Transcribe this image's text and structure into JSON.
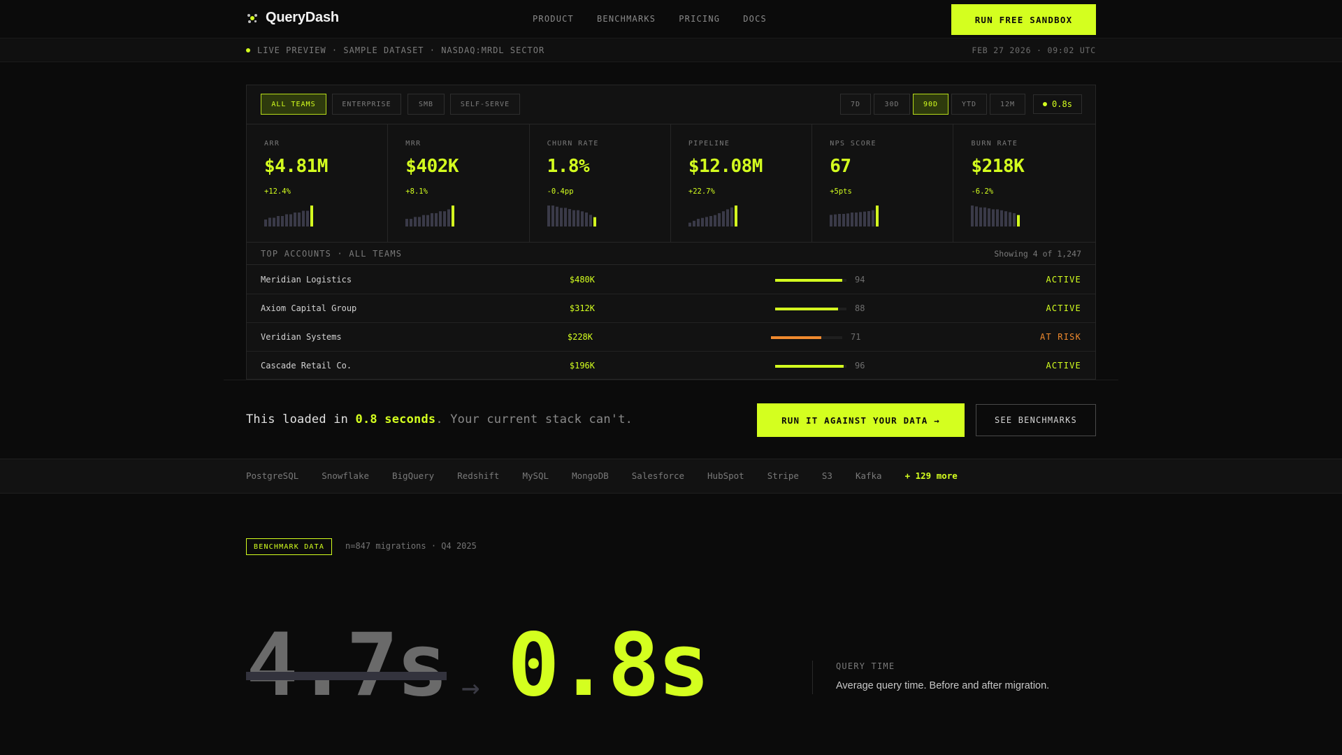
{
  "nav": {
    "brand": "QueryDash",
    "links": [
      "PRODUCT",
      "BENCHMARKS",
      "PRICING",
      "DOCS"
    ],
    "cta": "RUN FREE SANDBOX"
  },
  "livebar": {
    "text": "LIVE PREVIEW · SAMPLE DATASET · NASDAQ:MRDL SECTOR",
    "timestamp": "FEB 27 2026 · 09:02 UTC"
  },
  "filters": {
    "segments": [
      "ALL TEAMS",
      "ENTERPRISE",
      "SMB",
      "SELF-SERVE"
    ],
    "active_segment": "ALL TEAMS",
    "ranges": [
      "7D",
      "30D",
      "90D",
      "YTD",
      "12M"
    ],
    "active_range": "90D",
    "latency": "0.8s"
  },
  "kpis": [
    {
      "label": "ARR",
      "value": "$4.81M",
      "delta": "+12.4%",
      "spark": [
        4,
        5,
        5,
        6,
        6,
        7,
        7,
        8,
        8,
        9,
        9,
        12
      ]
    },
    {
      "label": "MRR",
      "value": "$402K",
      "delta": "+8.1%",
      "spark": [
        4,
        4,
        5,
        5,
        6,
        6,
        7,
        7,
        8,
        8,
        9,
        11
      ]
    },
    {
      "label": "CHURN RATE",
      "value": "1.8%",
      "delta": "-0.4pp",
      "spark": [
        9,
        9,
        8.5,
        8,
        8,
        7.5,
        7,
        7,
        6.5,
        6,
        5,
        4
      ]
    },
    {
      "label": "PIPELINE",
      "value": "$12.08M",
      "delta": "+22.7%",
      "spark": [
        2,
        3,
        4,
        4.5,
        5,
        5.5,
        6,
        7,
        8,
        9,
        10,
        11
      ]
    },
    {
      "label": "NPS SCORE",
      "value": "67",
      "delta": "+5pts",
      "spark": [
        5,
        5.2,
        5.4,
        5.4,
        5.6,
        6,
        6,
        6.2,
        6.4,
        6.6,
        7,
        9
      ]
    },
    {
      "label": "BURN RATE",
      "value": "$218K",
      "delta": "-6.2%",
      "spark": [
        11,
        10.5,
        10,
        10,
        9.5,
        9,
        9,
        8.5,
        8,
        7.5,
        7,
        6
      ]
    }
  ],
  "accounts": {
    "title": "TOP ACCOUNTS · ALL TEAMS",
    "count": "Showing 4 of 1,247",
    "rows": [
      {
        "name": "Meridian Logistics",
        "value": "$480K",
        "score": "94",
        "score_pct": 0.94,
        "status": "ACTIVE"
      },
      {
        "name": "Axiom Capital Group",
        "value": "$312K",
        "score": "88",
        "score_pct": 0.88,
        "status": "ACTIVE"
      },
      {
        "name": "Veridian Systems",
        "value": "$228K",
        "score": "71",
        "score_pct": 0.71,
        "status": "AT RISK"
      },
      {
        "name": "Cascade Retail Co.",
        "value": "$196K",
        "score": "96",
        "score_pct": 0.96,
        "status": "ACTIVE"
      }
    ]
  },
  "loaded": {
    "prefix": "This loaded in ",
    "highlight": "0.8 seconds",
    "suffix": ". Your current stack can't.",
    "run_button": "RUN IT AGAINST YOUR DATA →",
    "bench_button": "SEE BENCHMARKS"
  },
  "integrations": {
    "items": [
      "PostgreSQL",
      "Snowflake",
      "BigQuery",
      "Redshift",
      "MySQL",
      "MongoDB",
      "Salesforce",
      "HubSpot",
      "Stripe",
      "S3",
      "Kafka"
    ],
    "more": "+ 129 more"
  },
  "benchmark": {
    "badge": "BENCHMARK DATA",
    "meta": "n=847 migrations · Q4 2025",
    "before": "4.7s",
    "arrow": "→",
    "after": "0.8s",
    "label": "QUERY TIME",
    "description": "Average query time. Before and after migration."
  },
  "colors": {
    "accent": "#d4ff1f",
    "warning": "#f08a2e",
    "background": "#0b0b0b",
    "spark_muted": "#3a3a48"
  },
  "icons": {
    "brand": "brand-mark-icon",
    "live": "live-dot-icon",
    "latency": "status-dot-icon"
  }
}
